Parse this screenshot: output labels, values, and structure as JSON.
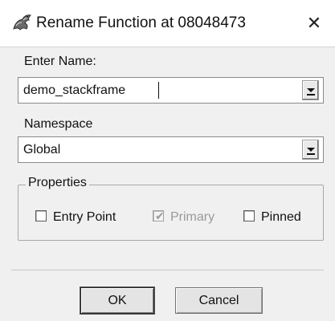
{
  "dialog": {
    "title": "Rename Function at 08048473",
    "app_icon": "dragon-app-icon",
    "close_glyph": "✕"
  },
  "name_field": {
    "label": "Enter Name:",
    "value": "demo_stackframe"
  },
  "namespace_field": {
    "label": "Namespace",
    "value": "Global"
  },
  "properties": {
    "legend": "Properties",
    "entry_point": {
      "label": "Entry Point",
      "checked": false,
      "enabled": true
    },
    "primary": {
      "label": "Primary",
      "checked": true,
      "enabled": false
    },
    "pinned": {
      "label": "Pinned",
      "checked": false,
      "enabled": true
    }
  },
  "buttons": {
    "ok": "OK",
    "cancel": "Cancel"
  }
}
